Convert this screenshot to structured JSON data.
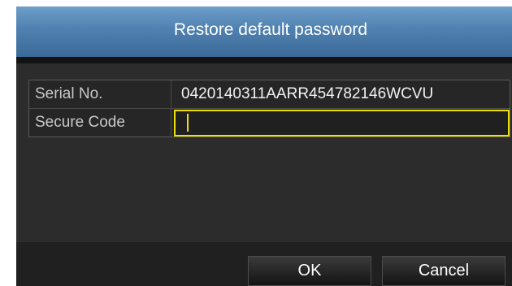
{
  "dialog": {
    "title": "Restore default password"
  },
  "form": {
    "serial_label": "Serial No.",
    "serial_value": "0420140311AARR454782146WCVU",
    "secure_label": "Secure Code",
    "secure_value": ""
  },
  "buttons": {
    "ok_label": "OK",
    "cancel_label": "Cancel"
  },
  "colors": {
    "focus_border": "#f0e000",
    "title_bar": "#4f81b0"
  }
}
